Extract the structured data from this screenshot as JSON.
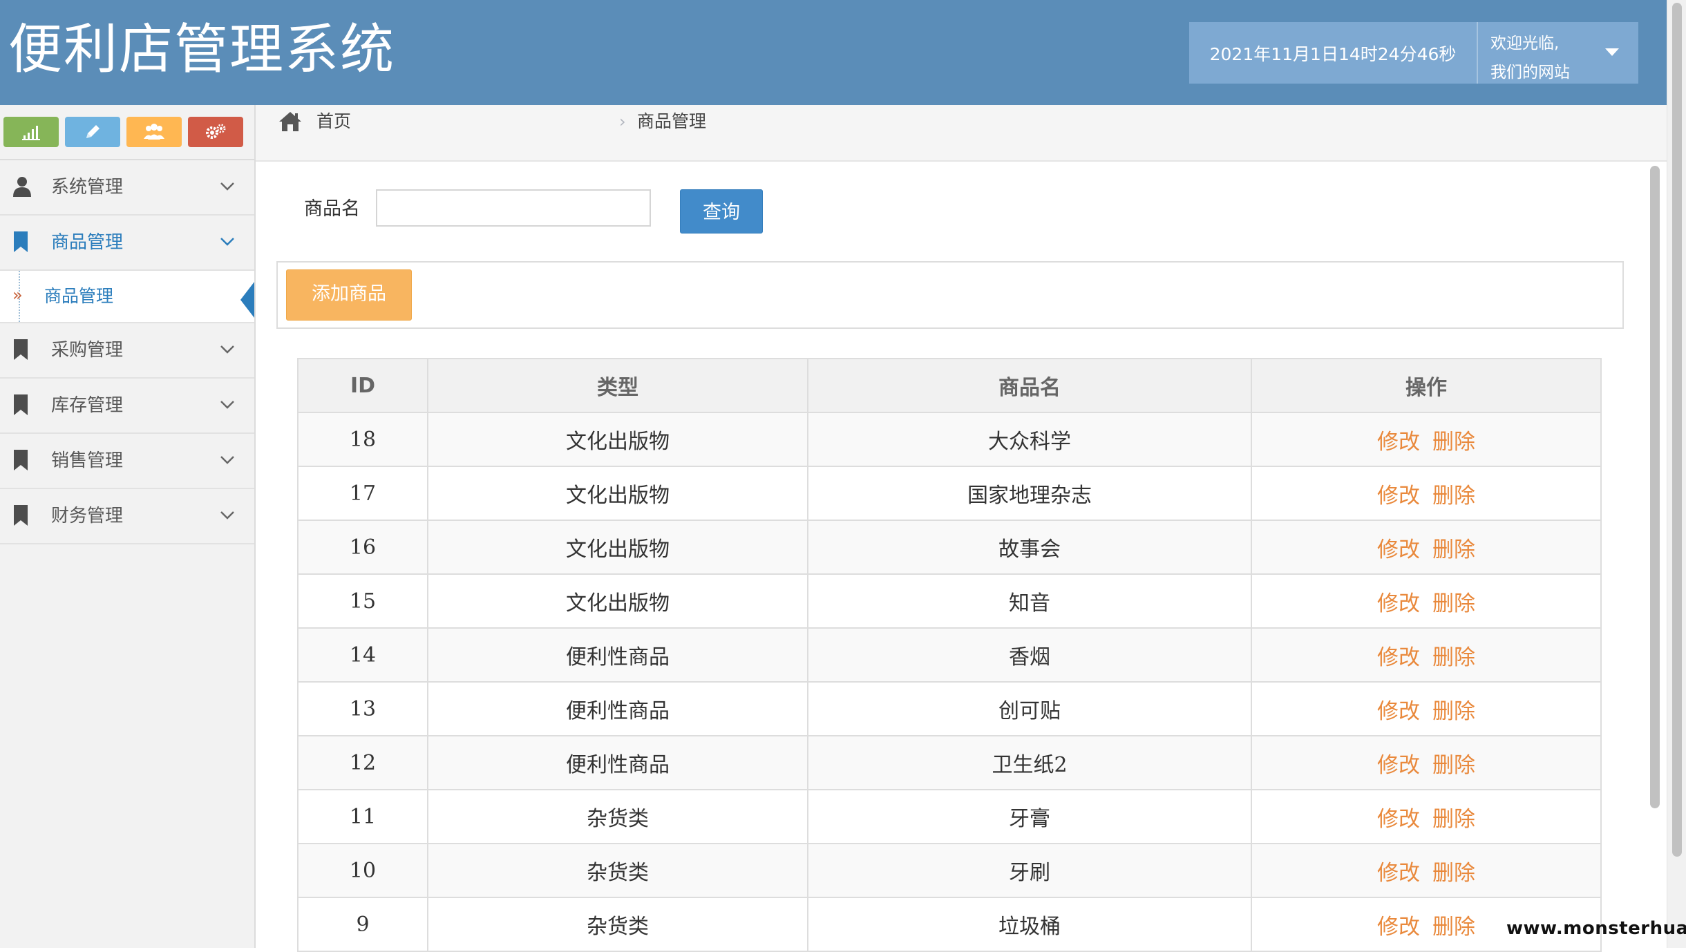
{
  "header": {
    "title": "便利店管理系统",
    "clock": "2021年11月1日14时24分46秒",
    "welcome_line1": "欢迎光临,",
    "welcome_line2": "我们的网站"
  },
  "sidebar": {
    "shortcuts": [
      {
        "icon": "bar-chart-icon",
        "color": "#86b558"
      },
      {
        "icon": "pencil-icon",
        "color": "#6fb3e0"
      },
      {
        "icon": "users-icon",
        "color": "#ffb752"
      },
      {
        "icon": "cogs-icon",
        "color": "#d15b47"
      }
    ],
    "items": [
      {
        "label": "系统管理",
        "icon": "user-icon"
      },
      {
        "label": "商品管理",
        "icon": "bookmark-icon",
        "open": true
      },
      {
        "label": "采购管理",
        "icon": "bookmark-icon"
      },
      {
        "label": "库存管理",
        "icon": "bookmark-icon"
      },
      {
        "label": "销售管理",
        "icon": "bookmark-icon"
      },
      {
        "label": "财务管理",
        "icon": "bookmark-icon"
      }
    ],
    "subitem": {
      "label": "商品管理"
    }
  },
  "breadcrumb": {
    "home": "首页",
    "current": "商品管理"
  },
  "search": {
    "label": "商品名",
    "value": "",
    "button": "查询"
  },
  "toolbar": {
    "add_label": "添加商品"
  },
  "table": {
    "columns": [
      "ID",
      "类型",
      "商品名",
      "操作"
    ],
    "rows": [
      {
        "id": "18",
        "type": "文化出版物",
        "name": "大众科学"
      },
      {
        "id": "17",
        "type": "文化出版物",
        "name": "国家地理杂志"
      },
      {
        "id": "16",
        "type": "文化出版物",
        "name": "故事会"
      },
      {
        "id": "15",
        "type": "文化出版物",
        "name": "知音"
      },
      {
        "id": "14",
        "type": "便利性商品",
        "name": "香烟"
      },
      {
        "id": "13",
        "type": "便利性商品",
        "name": "创可贴"
      },
      {
        "id": "12",
        "type": "便利性商品",
        "name": "卫生纸2"
      },
      {
        "id": "11",
        "type": "杂货类",
        "name": "牙膏"
      },
      {
        "id": "10",
        "type": "杂货类",
        "name": "牙刷"
      },
      {
        "id": "9",
        "type": "杂货类",
        "name": "垃圾桶"
      }
    ],
    "edit_label": "修改",
    "delete_label": "删除"
  },
  "colors": {
    "header_bg": "#5b8db8",
    "primary": "#428bca",
    "warning": "#f8b560",
    "action_link": "#e9893c",
    "active_menu": "#2b7dbc"
  },
  "watermark": "www.monsterhua.com"
}
